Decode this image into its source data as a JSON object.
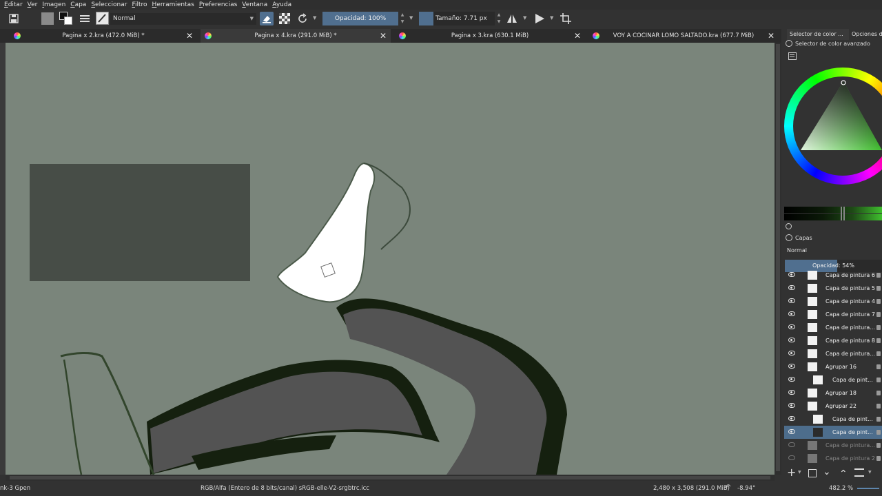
{
  "menu": [
    {
      "pre": "",
      "u": "E",
      "post": "ditar"
    },
    {
      "pre": "",
      "u": "V",
      "post": "er"
    },
    {
      "pre": "",
      "u": "I",
      "post": "magen"
    },
    {
      "pre": "",
      "u": "C",
      "post": "apa"
    },
    {
      "pre": "",
      "u": "S",
      "post": "eleccionar"
    },
    {
      "pre": "",
      "u": "F",
      "post": "iltro"
    },
    {
      "pre": "",
      "u": "H",
      "post": "erramientas"
    },
    {
      "pre": "",
      "u": "P",
      "post": "referencias"
    },
    {
      "pre": "",
      "u": "V",
      "post": "entana"
    },
    {
      "pre": "",
      "u": "A",
      "post": "yuda"
    }
  ],
  "toolbar": {
    "blend_mode": "Normal",
    "opacity_label": "Opacidad: 100%",
    "size_label": "Tamaño: 7.71 px"
  },
  "tabs": [
    {
      "label": "Pagina x 2.kra (472.0 MiB) *",
      "close": "✕"
    },
    {
      "label": "Pagina x 4.kra (291.0 MiB) *",
      "close": "✕"
    },
    {
      "label": "Pagina x 3.kra (630.1 MiB)",
      "close": "✕"
    },
    {
      "label": "VOY A COCINAR LOMO SALTADO.kra (677.7 MiB)",
      "close": "✕"
    }
  ],
  "dock": {
    "tab_color": "Selector de color ...",
    "tab_options": "Opciones de",
    "color_panel_title": "Selector de color avanzado",
    "layers_title": "Capas",
    "layers_blend": "Normal",
    "layers_opacity_label": "Opacidad:",
    "layers_opacity_value": "54%",
    "layers_opacity": 0.54
  },
  "layers": [
    {
      "name": "Capa de pintura 6",
      "visible": true
    },
    {
      "name": "Capa de pintura 5",
      "visible": true
    },
    {
      "name": "Capa de pintura 4",
      "visible": true
    },
    {
      "name": "Capa de pintura 7",
      "visible": true
    },
    {
      "name": "Capa de pintura...",
      "visible": true
    },
    {
      "name": "Capa de pintura 8",
      "visible": true
    },
    {
      "name": "Capa de pintura...",
      "visible": true
    },
    {
      "name": "Agrupar 16",
      "visible": true
    },
    {
      "name": "Capa de pint...",
      "visible": true
    },
    {
      "name": "Agrupar 18",
      "visible": true
    },
    {
      "name": "Agrupar 22",
      "visible": true
    },
    {
      "name": "Capa de pint...",
      "visible": true
    },
    {
      "name": "Capa de pint...",
      "visible": true,
      "selected": true
    },
    {
      "name": "Capa de pintura...",
      "visible": false
    },
    {
      "name": "Capa de pintura 2",
      "visible": false
    }
  ],
  "status": {
    "brush": "nk-3 Gpen",
    "color_space": "RGB/Alfa (Entero de 8 bits/canal)  sRGB-elle-V2-srgbtrc.icc",
    "dimensions": "2,480 x 3,508 (291.0 MiB)",
    "rotation": "-8.94°",
    "zoom": "482.2 %"
  },
  "colors": {
    "canvas_bg": "#7a857b",
    "accent": "#506f8f",
    "selected_layer": "#4d6d8c"
  }
}
